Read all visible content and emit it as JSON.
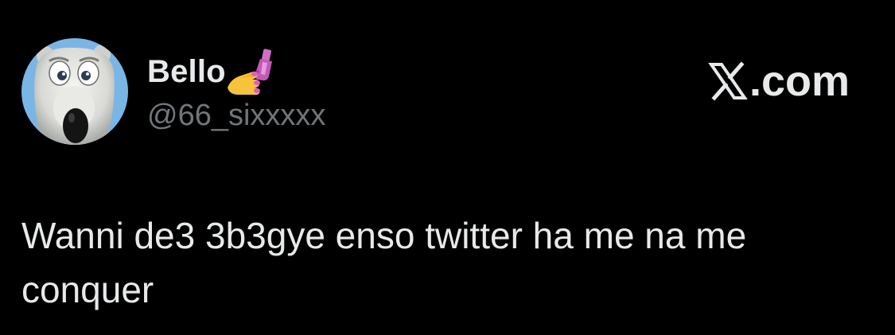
{
  "user": {
    "display_name": "Bello",
    "display_name_emoji": "nail-polish-icon",
    "handle": "@66_sixxxxx",
    "avatar": "polar-bear-avatar"
  },
  "brand": {
    "logo": "x-logo-icon",
    "text": ".com"
  },
  "tweet": {
    "text": "Wanni de3 3b3gye enso twitter ha me na me conquer"
  },
  "colors": {
    "background": "#000000",
    "primary_text": "#e7e9ea",
    "secondary_text": "#71767b"
  }
}
